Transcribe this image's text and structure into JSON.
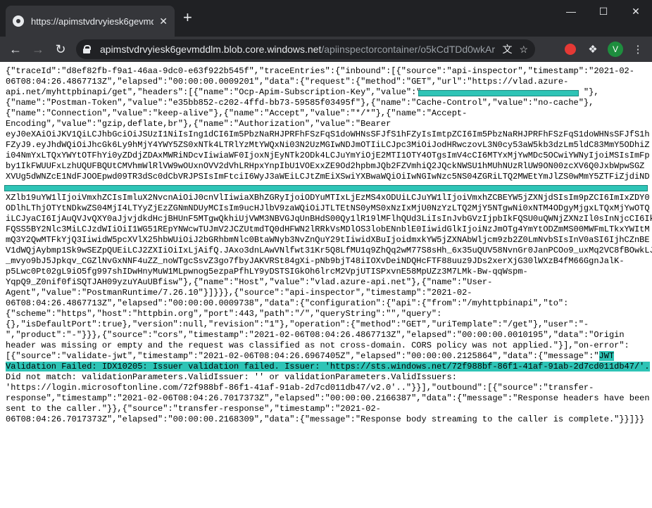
{
  "browser": {
    "tab_title": "https://apimstvdrvyiesk6gevmddl",
    "tab_close": "✕",
    "new_tab": "+",
    "url_host": "apimstvdrvyiesk6gevmddlm.blob.core.windows.net",
    "url_path": "/apiinspectorcontainer/o5kCdTDd0wkAr...",
    "avatar_letter": "V"
  },
  "content": {
    "lines": [
      "{\"traceId\":\"d8ef82fb-f9a1-46aa-9dc0-e63f922b545f\",\"traceEntries\":{\"inbound\":[{\"source\":\"api-inspector\",\"timestamp\":\"2021-02-",
      "06T08:04:26.4867713Z\",\"elapsed\":\"00:00:00.0009201\",\"data\":{\"request\":{\"method\":\"GET\",\"url\":\"https://vlad.azure-",
      "api.net/myhttpbinapi/get\",\"headers\":[{\"name\":\"Ocp-Apim-Subscription-Key\",\"value\":\"                                \"},",
      "{\"name\":\"Postman-Token\",\"value\":\"e35bb852-c202-4ffd-bb73-59585f03495f\"},{\"name\":\"Cache-Control\",\"value\":\"no-cache\"},",
      "{\"name\":\"Connection\",\"value\":\"keep-alive\"},{\"name\":\"Accept\",\"value\":\"*/*\"},{\"name\":\"Accept-",
      "Encoding\",\"value\":\"gzip,deflate,br\"},{\"name\":\"Authorization\",\"value\":\"Bearer",
      "eyJ0eXAiOiJKV1QiLCJhbGciOiJSUzI1NiIsIng1dCI6Im5PbzNaRHJPRFhFSzFqS1doWHNsSFJfS1hFZyIsImtpZCI6Im5PbzNaRHJPRFhFSzFqS1doWHNsSFJfS1h",
      "FZyJ9.eyJhdWQiOiJhcGk6Ly9hMjY4YWY5ZS0xNTk4LTRlYzMtYWQxNi03N2UzMGIwNDJmOTIiLCJpc3MiOiJodHRwczovL3N0cy53aW5kb3dzLm5ldC83MmY5ODhiZ",
      "i04NmYxLTQxYWYtOTFhYi0yZDdjZDAxMWRiNDcvIiwiaWF0IjoxNjEyNTk2ODk4LCJuYmYiOjE2MTI1OTY4OTgsImV4cCI6MTYxMjYwMDc5OCwiYWNyIjoiMSIsImFp",
      "by1IkFWUUFxLzhUQUFBQUtCMVhmWlRlVW9wOUxnOVV2dVhLRHpxYnpIbU1VOExxZE9Od2hpbmJQb2FZVmhiQ2JQckNWSU1hMUhNUzRlUW9ON00zcXV6Q0JxbWpwSGZ",
      "XVUg5dWNZcE1NdFJOOEpwd09TR3dSc0dCbVRJPSIsImFtciI6WyJ3aWEiLCJtZmEiXSwiYXBwaWQiOiIwNGIwNzc5NS04ZGRiLTQ2MWEtYmJlZS0wMmY5ZTFiZjdiND",
      "                                                                                                                                 ",
      "XZlb19uYW1lIjoiVmxhZCIsImluX2NvcnAiOiJ0cnVlIiwiaXBhZGRyIjoiODYuMTIxLjEzMS4xODUiLCJuYW1lIjoiVmxhZCBEYW5jZXNjdSIsIm9pZCI6ImIxZDY0",
      "ODlhLThjOTYtNDkwZS04MjI4LTYyZjEzZGNmNDUyMCIsIm9ucHJlbV9zaWQiOiJTLTEtNS0yMS0xNzIxMjU0NzYzLTQ2MjY5NTgwNi0xNTM4ODgyMjgxLTQxMjYwOTQ",
      "iLCJyaCI6IjAuQVJvQXY0aJjvjdkdHcjBHUnF5MTgwQkhiUjVWM3NBVGJqUnBHdS00Qy1lR19lMFlhQUd3LiIsInJvbGVzIjpbIkFQSU0uQWNjZXNzIl0sInNjcCI6Ik",
      "FQSS5BY2Nlc3MiLCJzdWIiOiI1WG51REpYNWcwTUJmV2JCZUtmdTQ0dHFWN2lRRkVsMDlOS3lobENnblE0IiwidGlkIjoiNzJmOTg4YmYtODZmMS00MWFmLTkxYWItM",
      "mQ3Y2QwMTFkYjQ3IiwidW5pcXVlX25hbWUiOiJ2bGRhbmNlc0BtaWNyb3NvZnQuY29tIiwidXBuIjoidmxkYW5jZXNAbWljcm9zb2Z0LmNvbSIsInV0aSI6IjhCZnBE",
      "V1dWQjAybmp1Sk9wSEZpQUEiLCJ2ZXIiOiIxLjAifQ.JAxo3dnLAwVNlfwt31Kr5Q8LfMU1q9ZhQq2wM77S8sHh_6x35uQUV58NvnGr0JanPCOo9_uxMq2VC8fBOwkLJ",
      "_mvyo9bJ5Jpkqv_CGZlNvGxNNF4uZZ_noWTgcSsvZ3go7fbyJAKVRSt84gXi-pNb9bjT48iIOXvDeiNDQHcFTF88uuz9JDs2xerXjG30lWXzB4fM66GgnJalK-",
      "p5Lwc0Pt02gL9iO5fg997shIDwHnyMuW1MLpwnog5ezpaPfhLY9yDSTSIGkOh6lrcM2VpjUTISPxvnE58MpUZz3M7LMk-Bw-qqWspm-",
      "YqpQ9_Z0nif0fiSQTJAH09yzuYAuUBfisw\"},{\"name\":\"Host\",\"value\":\"vlad.azure-api.net\"},{\"name\":\"User-",
      "Agent\",\"value\":\"PostmanRuntime/7.26.10\"}]}}},{\"source\":\"api-inspector\",\"timestamp\":\"2021-02-",
      "06T08:04:26.4867713Z\",\"elapsed\":\"00:00:00.0009738\",\"data\":{\"configuration\":{\"api\":{\"from\":\"/myhttpbinapi\",\"to\":",
      "{\"scheme\":\"https\",\"host\":\"httpbin.org\",\"port\":443,\"path\":\"/\",\"queryString\":\"\",\"query\":",
      "{},\"isDefaultPort\":true},\"version\":null,\"revision\":\"1\"},\"operation\":{\"method\":\"GET\",\"uriTemplate\":\"/get\"},\"user\":\"-",
      "\",\"product\":\"-\"}}},{\"source\":\"cors\",\"timestamp\":\"2021-02-06T08:04:26.4867713Z\",\"elapsed\":\"00:00:00.0010195\",\"data\":\"Origin",
      "header was missing or empty and the request was classified as not cross-domain. CORS policy was not applied.\"}],\"on-error\":",
      "[{\"source\":\"validate-jwt\",\"timestamp\":\"2021-02-06T08:04:26.6967405Z\",\"elapsed\":\"00:00:00.2125864\",\"data\":{\"message\":\"",
      "Validation Failed: IDX10205: Issuer validation failed. Issuer: 'https://sts.windows.net/72f988bf-86f1-41af-91ab-2d7cd011db47/'.",
      "Did not match: validationParameters.ValidIssuer: '' or validationParameters.ValidIssuers:",
      "'https://login.microsoftonline.com/72f988bf-86f1-41af-91ab-2d7cd011db47/v2.0'..\"}}],\"outbound\":[{\"source\":\"transfer-",
      "response\",\"timestamp\":\"2021-02-06T08:04:26.7017373Z\",\"elapsed\":\"00:00:00.2166387\",\"data\":{\"message\":\"Response headers have been",
      "sent to the caller.\"}},{\"source\":\"transfer-response\",\"timestamp\":\"2021-02-",
      "06T08:04:26.7017373Z\",\"elapsed\":\"00:00:00.2168309\",\"data\":{\"message\":\"Response body streaming to the caller is complete.\"}}]}}"
    ],
    "jwt_highlight_start": "JWT"
  }
}
